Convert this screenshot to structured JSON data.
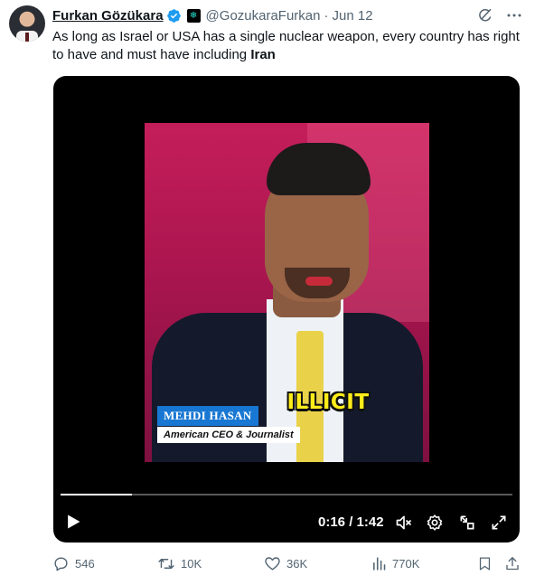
{
  "author": {
    "name": "Furkan Gözükara",
    "handle": "@GozukaraFurkan",
    "separator": "·",
    "date": "Jun 12",
    "affiliate_glyph": "❄"
  },
  "icons": {
    "verified": "verified-badge-icon",
    "grok": "grok-icon",
    "more": "more-icon"
  },
  "tweet": {
    "text_before": "As long as Israel or USA has a single nuclear weapon, every country has right to have and must have including ",
    "text_bold": "Iran"
  },
  "video": {
    "caption": "ILLICIT",
    "lower_third_name": "MEHDI HASAN",
    "lower_third_title": "American CEO & Journalist",
    "time_display": "0:16 / 1:42",
    "progress": 0.157
  },
  "actions": {
    "replies": "546",
    "reposts": "10K",
    "likes": "36K",
    "views": "770K"
  },
  "colors": {
    "verified_blue": "#1d9bf0",
    "muted_text": "#536471",
    "caption_yellow": "#ffec1a",
    "lower_third_blue": "#1877d2"
  }
}
